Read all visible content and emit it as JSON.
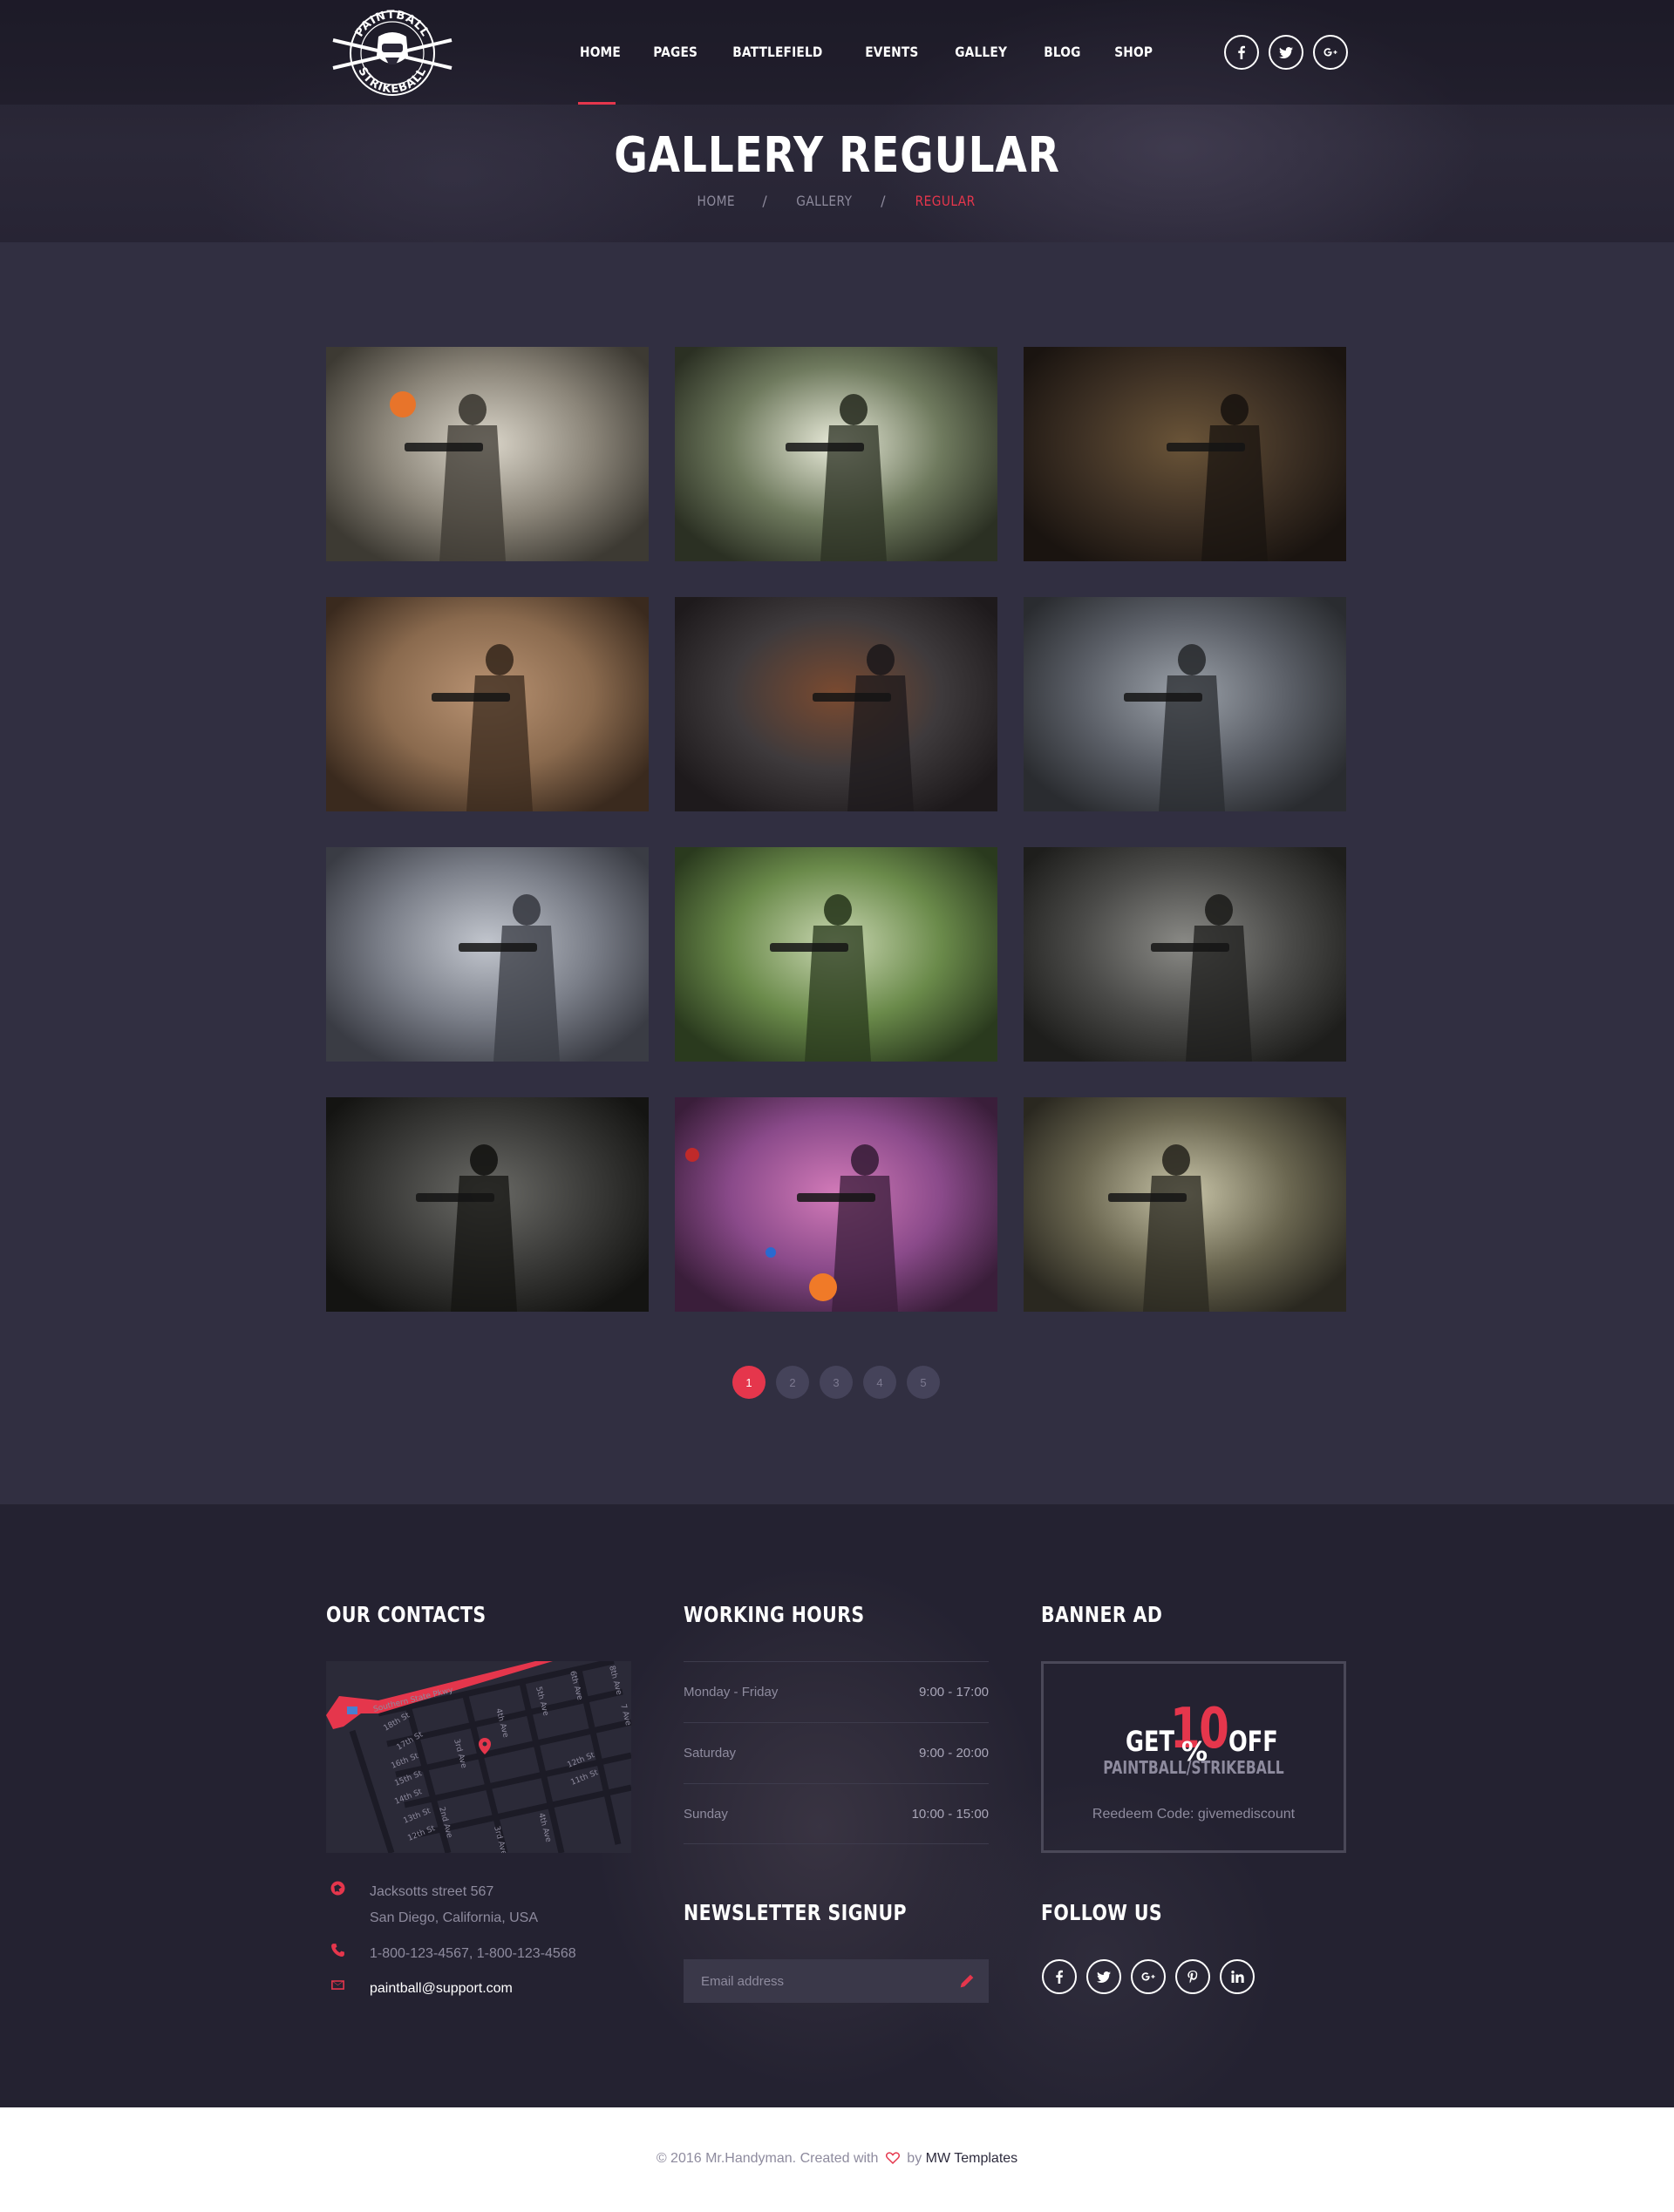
{
  "brand": {
    "logo_top": "PAINTBALL",
    "logo_bottom": "STRIKEBALL"
  },
  "nav": {
    "items": [
      "HOME",
      "PAGES",
      "BATTLEFIELD",
      "EVENTS",
      "GALLEY",
      "BLOG",
      "SHOP"
    ],
    "active": "HOME"
  },
  "social_top": [
    "facebook-icon",
    "twitter-icon",
    "google-plus-icon"
  ],
  "page": {
    "title": "GALLERY REGULAR",
    "breadcrumb": [
      "HOME",
      "GALLERY",
      "REGULAR"
    ],
    "breadcrumb_separator": "/"
  },
  "gallery": {
    "images": [
      "paintball-players-forest-orange-ball",
      "paintball-squad-running-woods",
      "paintball-player-prone-forest",
      "paintball-woman-bricks",
      "paintball-player-firing-smoke",
      "paintball-pair-back-to-back",
      "paintball-couple-posing",
      "paintball-smiling-player-camouflage",
      "soldier-portrait-boonie-hat",
      "soldier-kneeling-smoke",
      "paintball-woman-colorful-splash",
      "paintball-player-crouching-forest"
    ]
  },
  "pagination": {
    "pages": [
      "1",
      "2",
      "3",
      "4",
      "5"
    ],
    "current": "1"
  },
  "footer": {
    "contacts": {
      "heading": "OUR CONTACTS",
      "map_labels": {
        "highway": "Southern State Pkwy",
        "streets": [
          "18th St",
          "17th St",
          "16th St",
          "15th St",
          "14th St",
          "13th St",
          "12th St",
          "11th St",
          "12th St",
          "11th St"
        ],
        "avenues": [
          "3rd Ave",
          "4th Ave",
          "5th Ave",
          "6th Ave",
          "7 Ave",
          "8th Ave",
          "2nd Ave",
          "3rd Ave",
          "4th Ave"
        ]
      },
      "address_line1": "Jacksotts street 567",
      "address_line2": "San Diego, California, USA",
      "phone": "1-800-123-4567, 1-800-123-4568",
      "email": "paintball@support.com"
    },
    "hours": {
      "heading": "WORKING HOURS",
      "rows": [
        {
          "day": "Monday - Friday",
          "time": "9:00 - 17:00"
        },
        {
          "day": "Saturday",
          "time": "9:00 - 20:00"
        },
        {
          "day": "Sunday",
          "time": "10:00 - 15:00"
        }
      ]
    },
    "banner": {
      "heading": "BANNER AD",
      "get": "GET",
      "number": "10",
      "percent": "%",
      "off": "OFF",
      "subtitle": "PAINTBALL/STRIKEBALL",
      "code": "Reedeem Code: givemediscount"
    },
    "newsletter": {
      "heading": "NEWSLETTER SIGNUP",
      "placeholder": "Email address"
    },
    "follow": {
      "heading": "FOLLOW US",
      "icons": [
        "facebook-icon",
        "twitter-icon",
        "google-plus-icon",
        "pinterest-icon",
        "linkedin-icon"
      ]
    }
  },
  "copyright": {
    "prefix": "© 2016 Mr.Handyman. Created with",
    "by": "by",
    "brand": "MW Templates"
  },
  "colors": {
    "accent": "#e5364c",
    "background": "#312f41",
    "footer": "#242231"
  }
}
